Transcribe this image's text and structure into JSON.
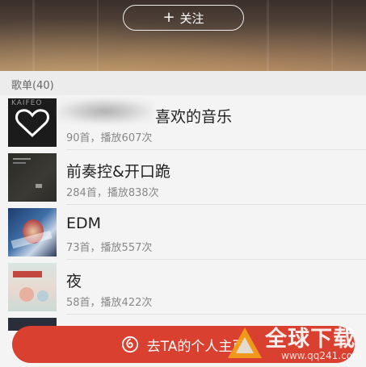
{
  "header": {
    "follow_label": "关注",
    "follow_icon": "plus-icon"
  },
  "section": {
    "title": "歌单(40)"
  },
  "playlists": [
    {
      "title": "喜欢的音乐",
      "meta": "90首，播放607次",
      "cover": "heart-cover",
      "cover_text": "KAIFEO"
    },
    {
      "title": "前奏控&开口跪",
      "meta": "284首，播放838次",
      "cover": "dark-album-cover"
    },
    {
      "title": "EDM",
      "meta": "73首，播放557次",
      "cover": "edm-art-cover"
    },
    {
      "title": "夜",
      "meta": "58首，播放422次",
      "cover": "pastel-art-cover"
    }
  ],
  "bottom": {
    "label": "去TA的个人主页",
    "icon": "netease-logo-icon",
    "accent": "#d9402f"
  },
  "watermark": {
    "title": "全球下载",
    "url": "www.qq241.com"
  }
}
